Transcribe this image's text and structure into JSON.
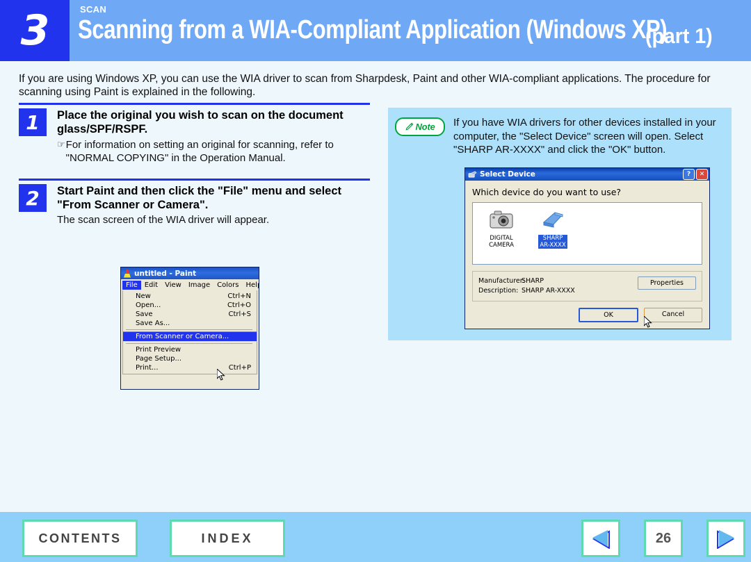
{
  "header": {
    "number": "3",
    "kicker": "SCAN",
    "title": "Scanning from a WIA-Compliant Application (Windows XP)",
    "part": "(part 1)"
  },
  "intro": "If you are using Windows XP, you can use the WIA driver to scan from Sharpdesk, Paint and other WIA-compliant applications. The procedure for scanning using Paint is explained in the following.",
  "steps": [
    {
      "number": "1",
      "heading": "Place the original you wish to scan on the document glass/SPF/RSPF.",
      "hand_glyph": "☞",
      "sub": "For information on setting an original for scanning, refer to \"NORMAL COPYING\" in the Operation Manual."
    },
    {
      "number": "2",
      "heading": "Start Paint and then click the \"File\" menu and select \"From Scanner or Camera\".",
      "plain": "The scan screen of the WIA driver will appear."
    }
  ],
  "paint_window": {
    "title": "untitled - Paint",
    "menus": [
      "File",
      "Edit",
      "View",
      "Image",
      "Colors",
      "Help"
    ],
    "active_menu": "File",
    "menu_items": [
      {
        "label": "New",
        "accel": "Ctrl+N",
        "selected": false,
        "separator_after": false
      },
      {
        "label": "Open...",
        "accel": "Ctrl+O",
        "selected": false,
        "separator_after": false
      },
      {
        "label": "Save",
        "accel": "Ctrl+S",
        "selected": false,
        "separator_after": false
      },
      {
        "label": "Save As...",
        "accel": "",
        "selected": false,
        "separator_after": true
      },
      {
        "label": "From Scanner or Camera...",
        "accel": "",
        "selected": true,
        "separator_after": true
      },
      {
        "label": "Print Preview",
        "accel": "",
        "selected": false,
        "separator_after": false
      },
      {
        "label": "Page Setup...",
        "accel": "",
        "selected": false,
        "separator_after": false
      },
      {
        "label": "Print...",
        "accel": "Ctrl+P",
        "selected": false,
        "separator_after": false
      }
    ]
  },
  "note": {
    "badge_label": "Note",
    "text": "If you have WIA drivers for other devices installed in your computer, the \"Select Device\" screen will open. Select \"SHARP AR-XXXX\" and click the \"OK\" button."
  },
  "select_device_dialog": {
    "title": "Select Device",
    "help_button": "?",
    "close_button": "✕",
    "question": "Which device do you want to use?",
    "devices": [
      {
        "label": "DIGITAL\nCAMERA",
        "icon": "digital-camera-icon",
        "selected": false
      },
      {
        "label": "SHARP\nAR-XXXX",
        "icon": "scanner-icon",
        "selected": true
      }
    ],
    "details": [
      {
        "label": "Manufacturer:",
        "value": "SHARP"
      },
      {
        "label": "Description:",
        "value": "SHARP AR-XXXX"
      }
    ],
    "properties_button": "Properties",
    "ok_button": "OK",
    "cancel_button": "Cancel"
  },
  "footer": {
    "contents_label": "CONTENTS",
    "index_label": "INDEX",
    "page_number": "26",
    "prev_icon": "left-triangle-icon",
    "next_icon": "right-triangle-icon"
  },
  "colors": {
    "accent_blue": "#2233ee",
    "header_band": "#6fa8f5",
    "page_bg": "#eef7fc",
    "note_bg": "#ace0fb",
    "footer_bg": "#8fd0fb",
    "green_border": "#5fd9b0",
    "note_green": "#00a63c"
  }
}
